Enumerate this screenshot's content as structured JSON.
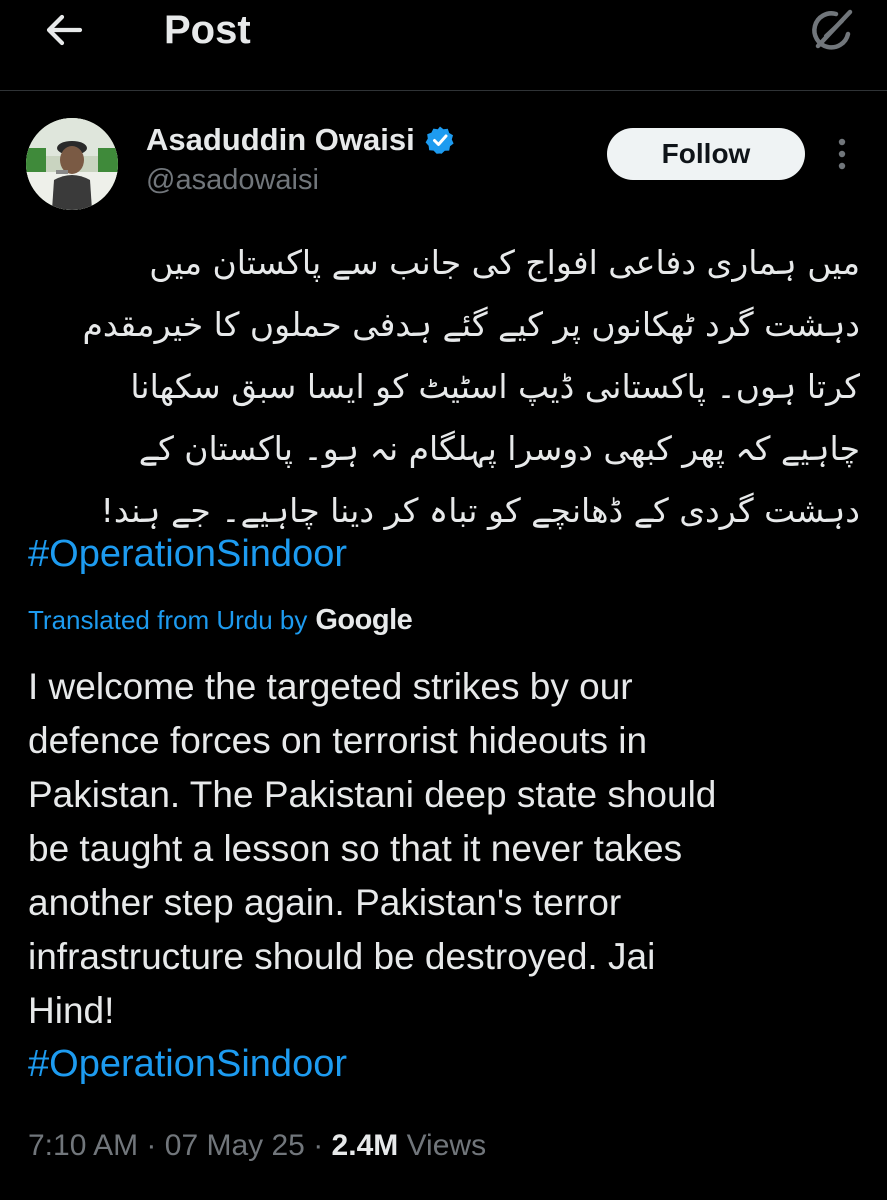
{
  "header": {
    "title": "Post",
    "back_icon": "arrow-left-icon",
    "grok_icon": "grok-slash-icon"
  },
  "author": {
    "name": "Asaduddin Owaisi",
    "handle": "@asadowaisi",
    "verified_icon": "verified-badge-icon",
    "verified_color": "#1d9bf0"
  },
  "follow_button": {
    "label": "Follow"
  },
  "more_icon": "more-vertical-icon",
  "post": {
    "urdu_lines": [
      "میں ہماری دفاعی افواج کی جانب سے پاکستان میں",
      "دہشت گرد ٹھکانوں پر کیے گئے ہدفی حملوں کا خیرمقدم",
      "کرتا ہوں۔ پاکستانی ڈیپ اسٹیٹ کو ایسا سبق سکھانا",
      "چاہیے کہ پھر کبھی دوسرا پہلگام نہ ہو۔ پاکستان کے",
      "دہشت گردی کے ڈھانچے کو تباہ کر دینا چاہیے۔ جے ہند!"
    ],
    "hashtag": "#OperationSindoor",
    "translated_label": "Translated from Urdu by",
    "translated_brand": "Google",
    "english_lines": [
      "I welcome the targeted strikes by our",
      "defence forces on terrorist hideouts in",
      "Pakistan. The Pakistani deep state should",
      "be taught a lesson so that it never takes",
      "another step again. Pakistan's terror",
      "infrastructure should be destroyed. Jai",
      "Hind!"
    ],
    "translated_hashtag": "#OperationSindoor"
  },
  "meta": {
    "time": "7:10 AM",
    "separator": "·",
    "date": "07 May 25",
    "views_count": "2.4M",
    "views_label": "Views"
  },
  "colors": {
    "background": "#000000",
    "text": "#e7e9ea",
    "secondary": "#71767b",
    "link": "#1d9bf0",
    "divider": "#2f3336"
  }
}
